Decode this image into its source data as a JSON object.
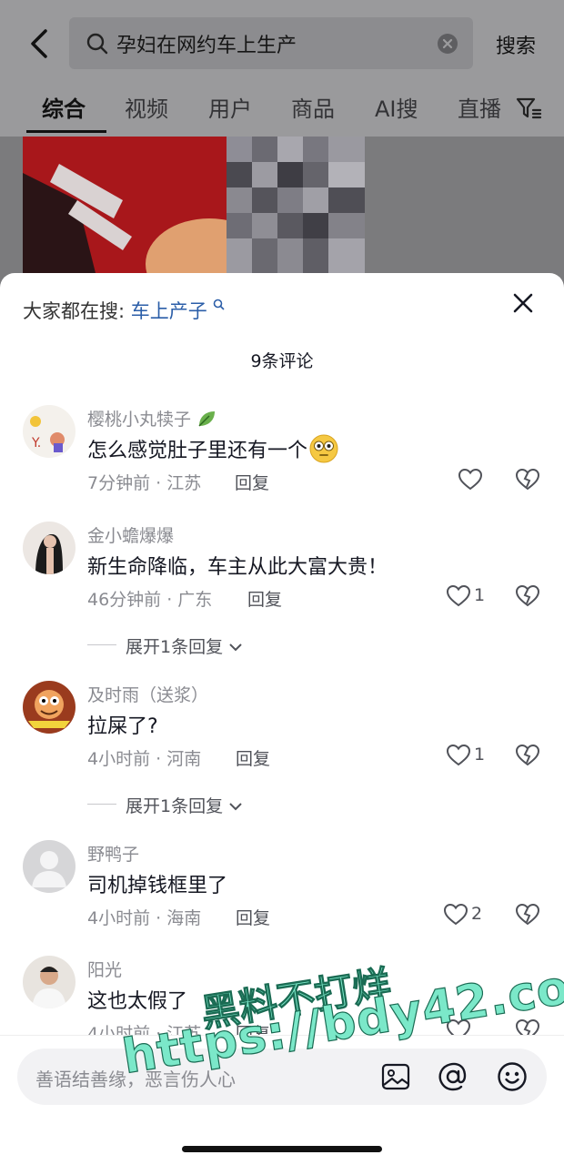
{
  "header": {
    "search_query": "孕妇在网约车上生产",
    "search_button": "搜索"
  },
  "tabs": [
    "综合",
    "视频",
    "用户",
    "商品",
    "AI搜",
    "直播"
  ],
  "panel": {
    "hot_search_prefix": "大家都在搜:",
    "hot_search_keyword": "车上产子",
    "comment_count": "9条评论"
  },
  "comments": [
    {
      "user": "樱桃小丸犊子",
      "text": "怎么感觉肚子里还有一个",
      "time": "7分钟前 · 江苏",
      "reply": "回复",
      "likes": ""
    },
    {
      "user": "金小蟾爆爆",
      "text": "新生命降临，车主从此大富大贵！",
      "time": "46分钟前 · 广东",
      "reply": "回复",
      "likes": "1",
      "expand": "展开1条回复"
    },
    {
      "user": "及时雨（送浆）",
      "text": "拉屎了?",
      "time": "4小时前 · 河南",
      "reply": "回复",
      "likes": "1",
      "expand": "展开1条回复"
    },
    {
      "user": "野鸭子",
      "text": "司机掉钱框里了",
      "time": "4小时前 · 海南",
      "reply": "回复",
      "likes": "2"
    },
    {
      "user": "阳光",
      "text": "这也太假了",
      "time": "4小时前 · 江苏",
      "reply": "回复",
      "likes": ""
    }
  ],
  "input": {
    "placeholder": "善语结善缘，恶言伤人心"
  },
  "watermark": {
    "line1": "黑料不打烊",
    "line2": "https://bdy42.co"
  },
  "icons": [
    "back-icon",
    "search-icon",
    "clear-icon",
    "filter-icon",
    "close-icon",
    "heart-icon",
    "broken-heart-icon",
    "image-icon",
    "at-icon",
    "emoji-icon"
  ]
}
